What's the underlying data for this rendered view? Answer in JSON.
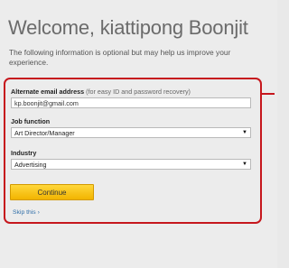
{
  "welcome": {
    "title": "Welcome, kiattipong Boonjit",
    "subtitle": "The following information is optional but may help us improve your experience."
  },
  "form": {
    "email": {
      "label": "Alternate email address",
      "hint": "(for easy ID and password recovery)",
      "value": "kp.boonjit@gmail.com"
    },
    "job_function": {
      "label": "Job function",
      "selected": "Art Director/Manager"
    },
    "industry": {
      "label": "Industry",
      "selected": "Advertising"
    },
    "continue_label": "Continue",
    "skip_label": "Skip this ›"
  },
  "colors": {
    "highlight_border": "#c6171d",
    "button_yellow": "#f8c820",
    "link_blue": "#2f6ea8"
  },
  "icons": {
    "select_caret": "▼"
  }
}
